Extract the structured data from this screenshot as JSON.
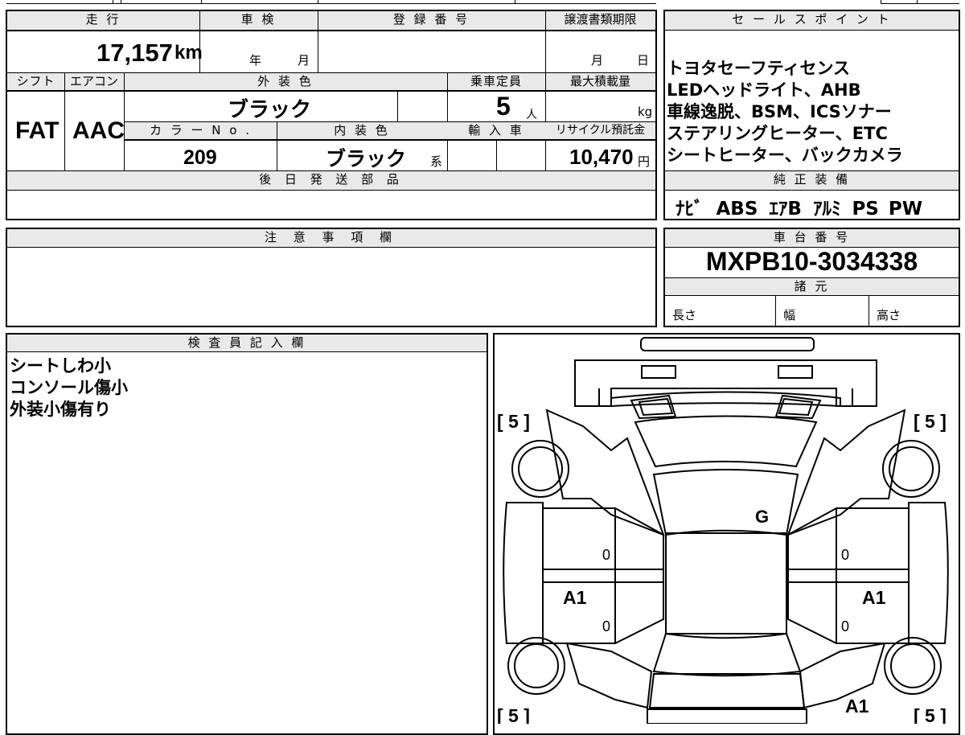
{
  "headers": {
    "mileage": "走 行",
    "inspection": "車 検",
    "registration": "登 録 番 号",
    "transfer_deadline": "譲渡書類期限",
    "shift": "シフト",
    "aircon": "エアコン",
    "exterior_color": "外 装 色",
    "capacity": "乗車定員",
    "max_load": "最大積載量",
    "color_no": "カ ラ ー  N o .",
    "interior_color": "内 装 色",
    "import": "輸 入 車",
    "recycle_fee": "リサイクル預託金",
    "later_parts": "後 日 発 送 部 品",
    "sales_point": "セ ー ル ス ポ イ ン ト",
    "standard_equipment": "純 正 装 備",
    "notes": "注 意 事 項 欄",
    "chassis_number": "車 台 番 号",
    "specs": "諸 元",
    "inspector_notes": "検 査 員 記 入 欄"
  },
  "values": {
    "mileage": "17,157",
    "mileage_unit": "km",
    "inspection_year_label": "年",
    "inspection_month_label": "月",
    "deadline_month_label": "月",
    "deadline_day_label": "日",
    "shift": "FAT",
    "aircon": "AAC",
    "exterior_color": "ブラック",
    "capacity": "5",
    "capacity_unit": "人",
    "max_load_unit": "kg",
    "color_no": "209",
    "interior_color": "ブラック",
    "interior_suffix": "系",
    "recycle_fee": "10,470",
    "recycle_unit": "円",
    "chassis_number": "MXPB10-3034338",
    "spec_length": "長さ",
    "spec_width": "幅",
    "spec_height": "高さ"
  },
  "sales_points": [
    "トヨタセーフティセンス",
    "LEDヘッドライト、AHB",
    "車線逸脱、BSM、ICSソナー",
    "ステアリングヒーター、ETC",
    "シートヒーター、バックカメラ"
  ],
  "equipment": [
    "ﾅﾋﾞ",
    "ABS",
    "ｴｱB",
    "ｱﾙﾐ",
    "PS",
    "PW"
  ],
  "inspector_notes": [
    "シートしわ小",
    "コンソール傷小",
    "外装小傷有り"
  ],
  "diagram": {
    "tire_fl": "[ 5 ]",
    "tire_fr": "[ 5 ]",
    "tire_rl": "[ 5 ]",
    "tire_rr": "[ 5 ]",
    "glass_mark": "G",
    "left_front_door_mark": "0",
    "left_rear_door_mark": "0",
    "right_front_door_mark": "0",
    "right_rear_door_mark": "0",
    "left_side_mark": "A1",
    "right_side_mark": "A1",
    "rear_right_mark": "A1"
  }
}
